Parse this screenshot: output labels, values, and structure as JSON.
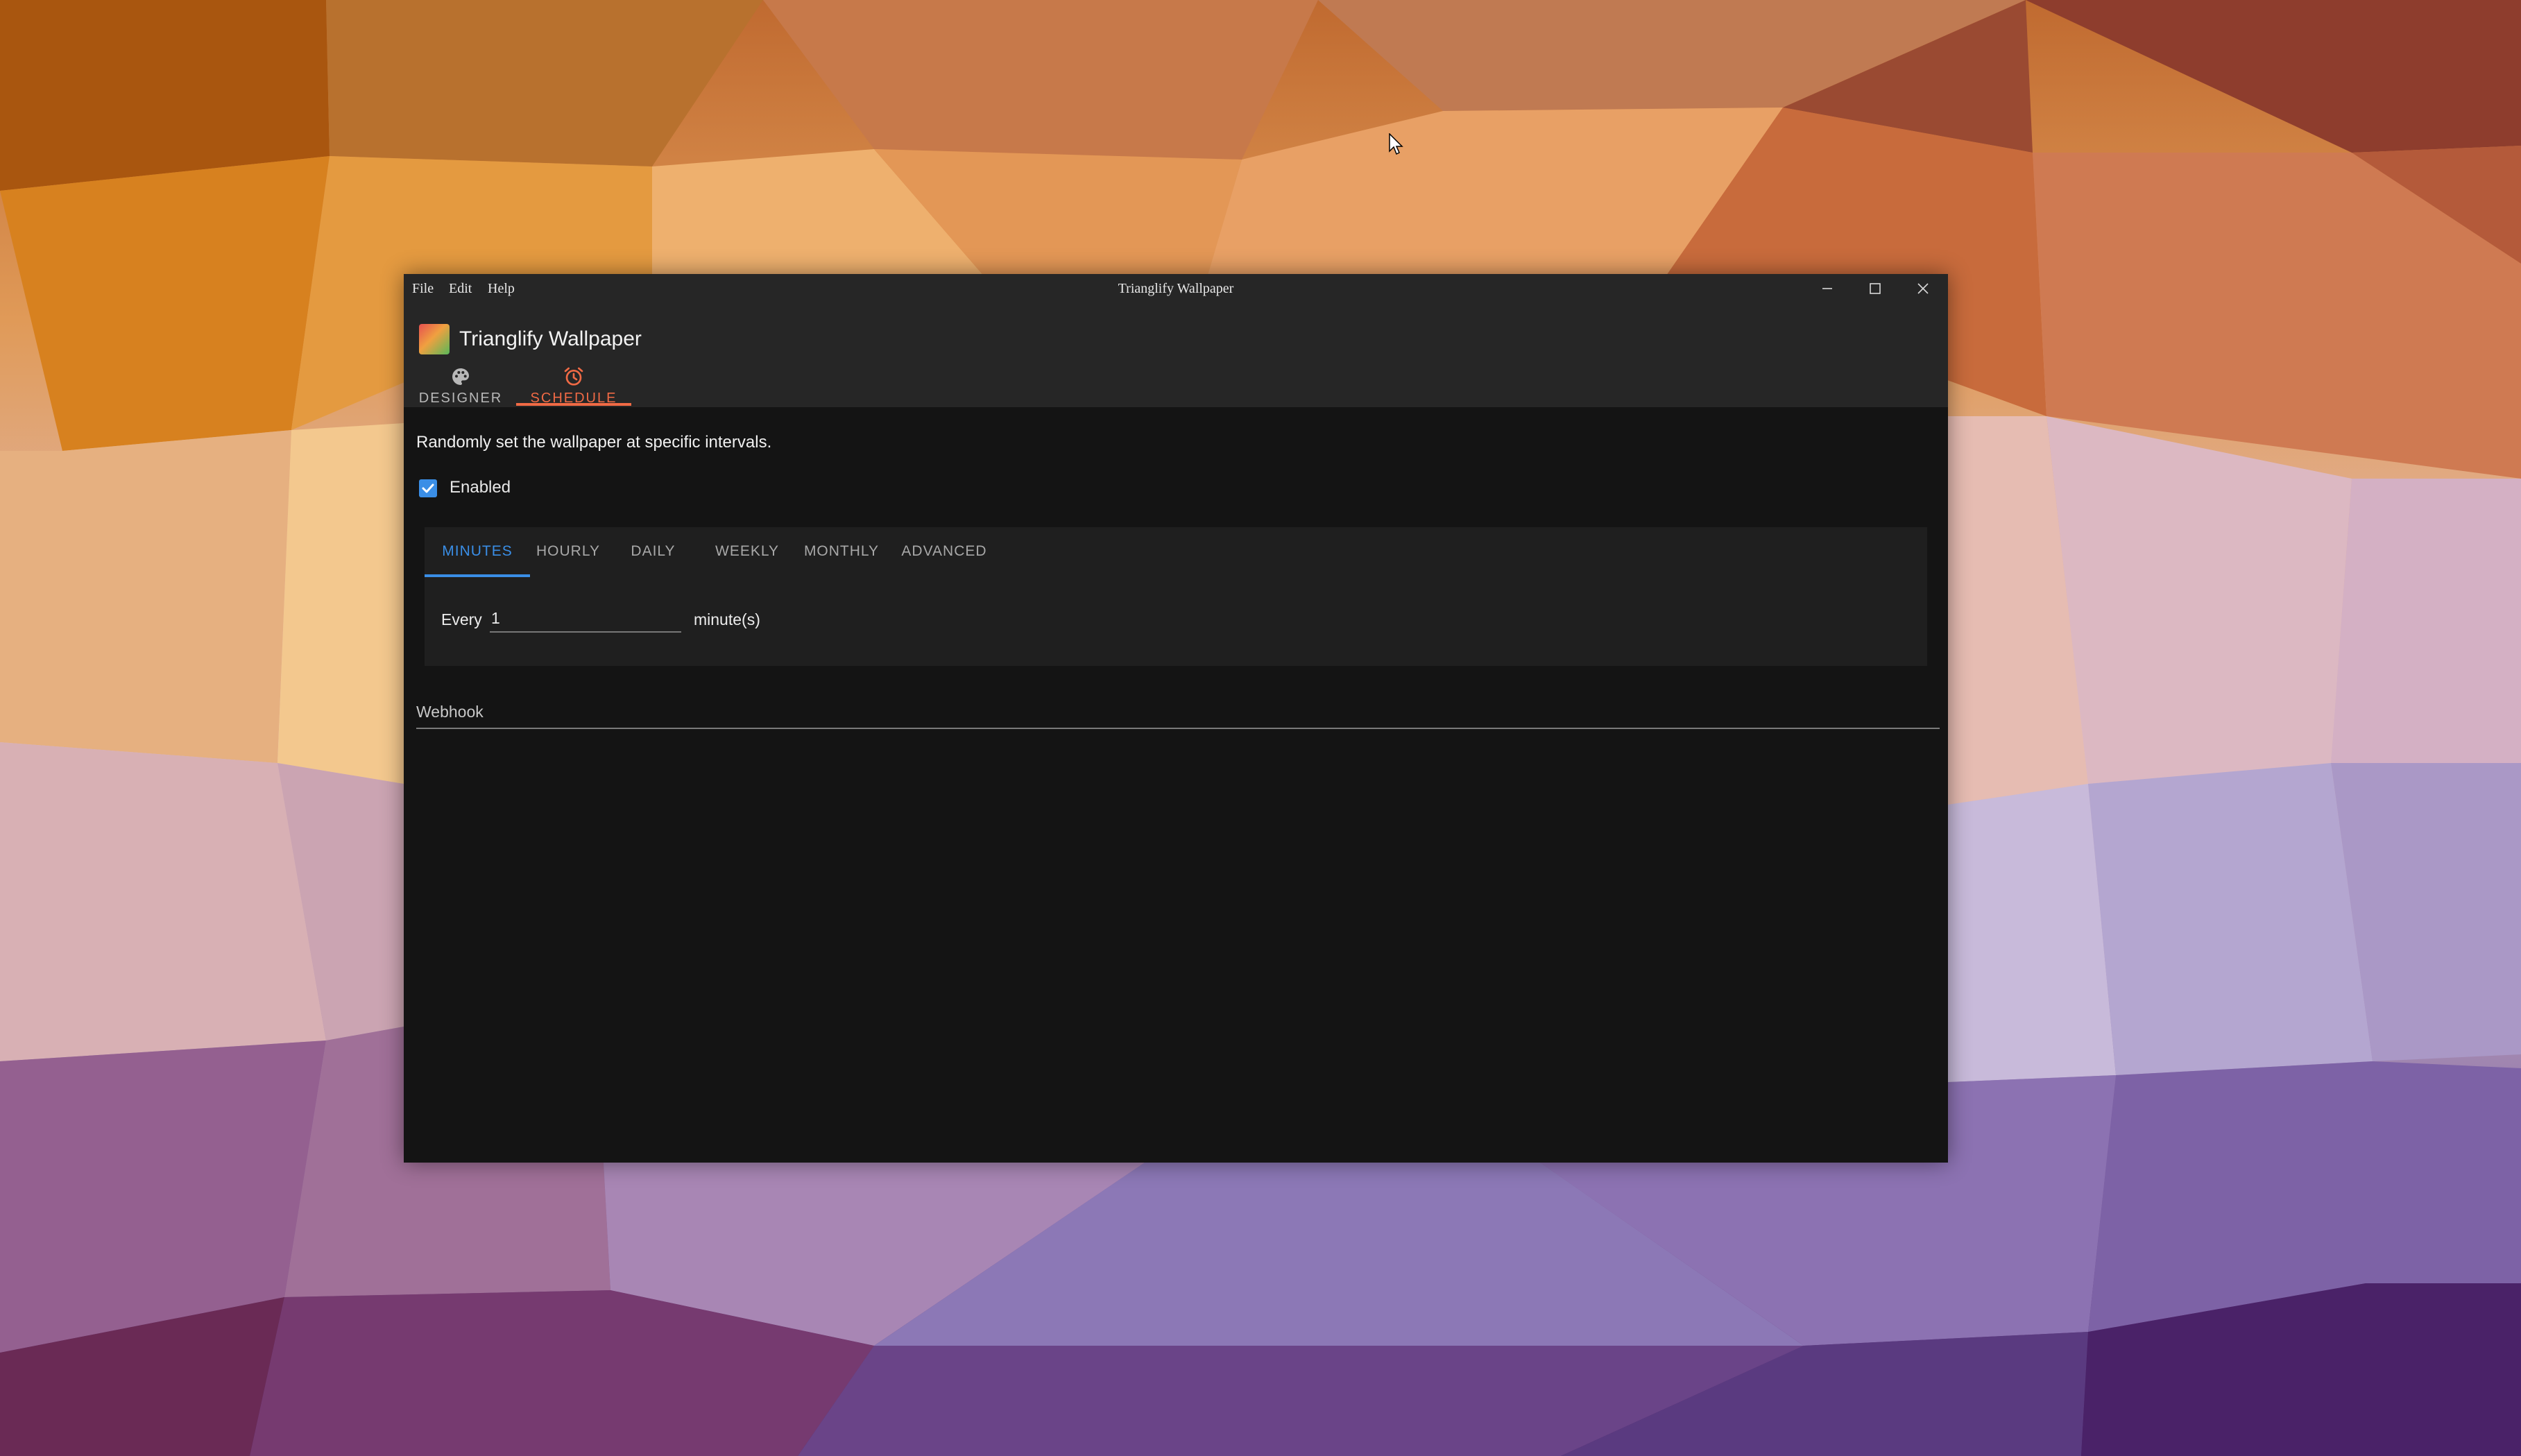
{
  "window": {
    "title": "Trianglify Wallpaper",
    "menu": [
      "File",
      "Edit",
      "Help"
    ]
  },
  "app": {
    "title": "Trianglify Wallpaper",
    "tabs": [
      {
        "label": "DESIGNER",
        "icon": "palette-icon",
        "active": false
      },
      {
        "label": "SCHEDULE",
        "icon": "alarm-clock-icon",
        "active": true
      }
    ]
  },
  "schedule": {
    "description": "Randomly set the wallpaper at specific intervals.",
    "enabled_label": "Enabled",
    "enabled": true,
    "tabs": [
      "MINUTES",
      "HOURLY",
      "DAILY",
      "WEEKLY",
      "MONTHLY",
      "ADVANCED"
    ],
    "active_tab": "MINUTES",
    "every_label": "Every",
    "interval_value": "1",
    "unit_label": "minute(s)"
  },
  "webhook": {
    "label": "Webhook"
  },
  "colors": {
    "accent_orange": "#f06a45",
    "accent_blue": "#3a8ee6",
    "window_bg": "#141414",
    "header_bg": "#262626",
    "panel_bg": "#1f1f1f"
  }
}
